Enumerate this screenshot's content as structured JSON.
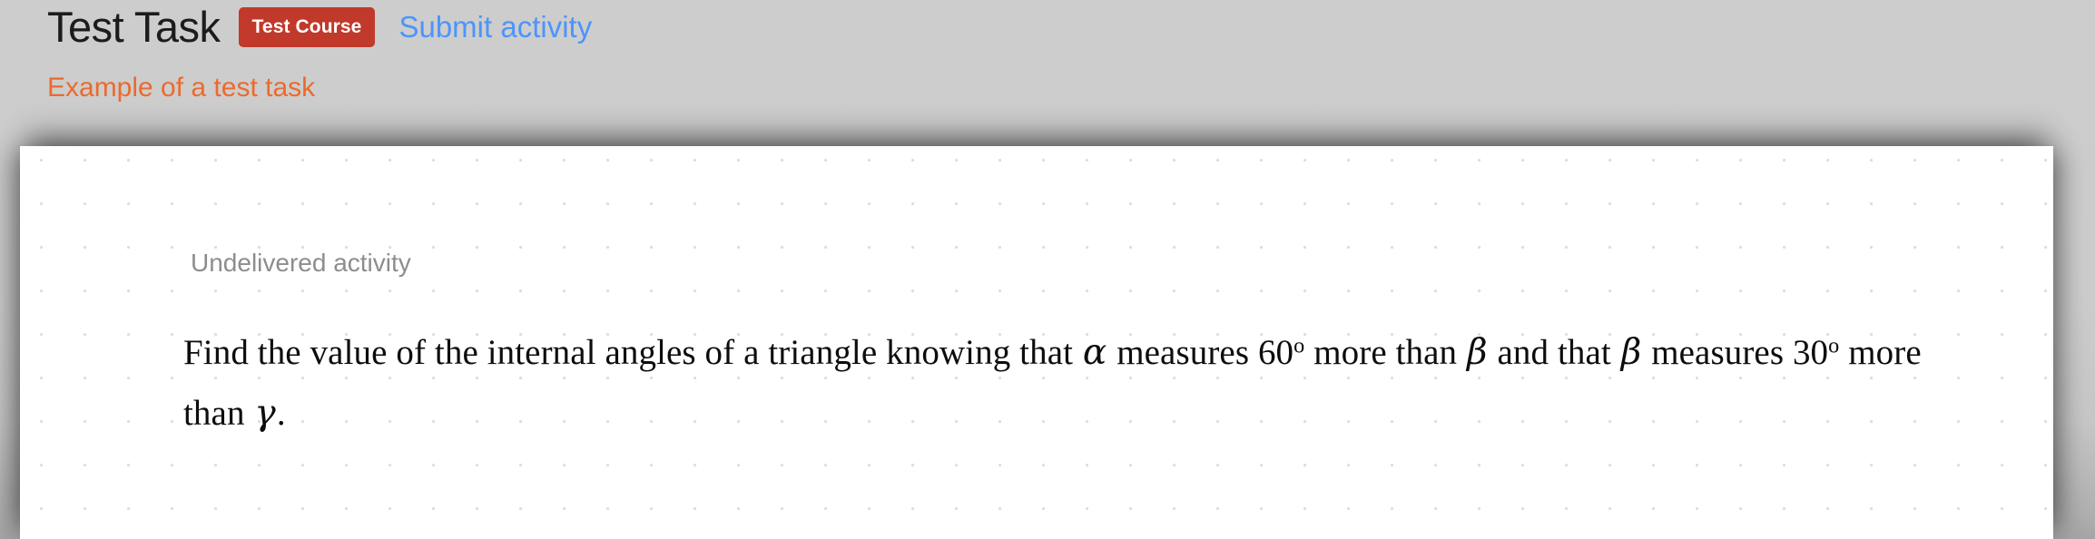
{
  "header": {
    "title": "Test Task",
    "course_badge": "Test Course",
    "submit_link": "Submit activity",
    "subtitle": "Example of a test task"
  },
  "card": {
    "status_label": "Undelivered activity",
    "problem": {
      "seg1": "Find the value of the internal angles of a triangle knowing that ",
      "alpha": "α",
      "seg2": " measures 60",
      "deg1": "o",
      "seg3": " more than ",
      "beta1": "β",
      "seg4": " and that ",
      "beta2": "β",
      "seg5": " measures 30",
      "deg2": "o",
      "seg6": " more than ",
      "gamma": "γ",
      "seg7": ".",
      "full_text": "Find the value of the internal angles of a triangle knowing that α measures 60º more than β and that β measures 30º more than γ."
    }
  },
  "colors": {
    "page_background": "#cccccc",
    "title_text": "#1c1c1c",
    "badge_background": "#c0392b",
    "badge_text": "#ffffff",
    "link_blue": "#4d94fb",
    "subtitle_orange": "#ec6a2c",
    "card_background": "#ffffff",
    "grid_dot": "#dddddd",
    "status_gray": "#8d8d8d",
    "problem_text": "#0d0d0d"
  }
}
